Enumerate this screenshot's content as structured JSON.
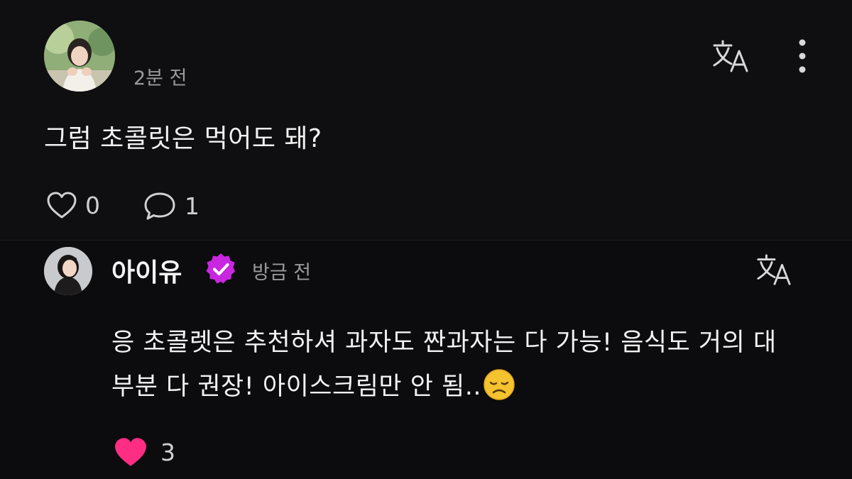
{
  "post": {
    "time": "2분 전",
    "text": "그럼 초콜릿은 먹어도 돼?",
    "likes": "0",
    "comments": "1"
  },
  "reply": {
    "author": "아이유",
    "time": "방금 전",
    "text": "응 초콜렛은 추천하셔 과자도 짠과자는 다 가능! 음식도 거의 대부분 다 권장! 아이스크림만 안 됨..",
    "likes": "3"
  },
  "icons": {
    "translate": "translate-icon",
    "more": "more-vertical-icon",
    "like": "heart-icon",
    "comment": "comment-bubble-icon",
    "verified": "verified-badge-icon",
    "emoji": "disappointed-face-emoji"
  },
  "colors": {
    "background": "#0f0e10",
    "text": "#f2f2f2",
    "muted": "#9a9a9e",
    "verified": "#c926e0",
    "liked_heart": "#ff2d84",
    "emoji": "#f5c230"
  }
}
